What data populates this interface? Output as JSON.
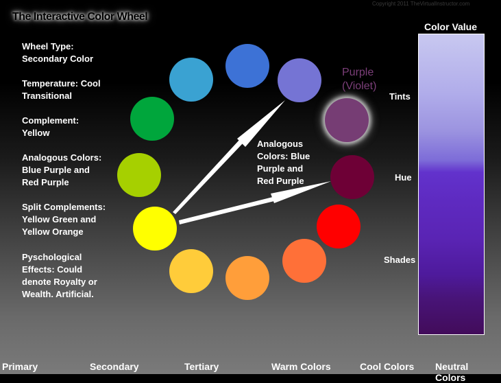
{
  "title": "The Interactive Color Wheel",
  "copyright": "Copyright 2011 TheVirtualInstructor.com",
  "info": {
    "wheel_type": [
      "Wheel Type:",
      "Secondary Color"
    ],
    "temperature": [
      "Temperature: Cool",
      "Transitional"
    ],
    "complement": [
      "Complement:",
      "Yellow"
    ],
    "analogous": [
      "Analogous Colors:",
      "Blue Purple and",
      "Red Purple"
    ],
    "split": [
      "Split Complements:",
      "Yellow Green and",
      "Yellow Orange"
    ],
    "psych": [
      "Pyschological",
      "Effects: Could",
      "denote Royalty or",
      "Wealth.  Artificial."
    ]
  },
  "wheel": {
    "colors": [
      {
        "name": "Blue",
        "hex": "#3d72d6"
      },
      {
        "name": "Blue Purple",
        "hex": "#7574d4"
      },
      {
        "name": "Purple",
        "hex": "#763d74",
        "selected": true
      },
      {
        "name": "Red Purple",
        "hex": "#6e0036"
      },
      {
        "name": "Red",
        "hex": "#ff0000"
      },
      {
        "name": "Red Orange",
        "hex": "#ff7038"
      },
      {
        "name": "Orange",
        "hex": "#ff9e3a"
      },
      {
        "name": "Yellow Orange",
        "hex": "#ffcc3a"
      },
      {
        "name": "Yellow",
        "hex": "#ffff00"
      },
      {
        "name": "Yellow Green",
        "hex": "#a6d000"
      },
      {
        "name": "Green",
        "hex": "#00a63c"
      },
      {
        "name": "Blue Green",
        "hex": "#3aa2d2"
      }
    ],
    "selected_label": [
      "Purple",
      "(Violet)"
    ],
    "analogous_label": [
      "Analogous",
      "Colors: Blue",
      "Purple and",
      "Red Purple"
    ]
  },
  "color_value": {
    "title": "Color Value",
    "labels": {
      "tints": "Tints",
      "hue": "Hue",
      "shades": "Shades"
    }
  },
  "nav": [
    "Primary",
    "Secondary",
    "Tertiary",
    "Warm Colors",
    "Cool Colors",
    "Neutral Colors"
  ]
}
